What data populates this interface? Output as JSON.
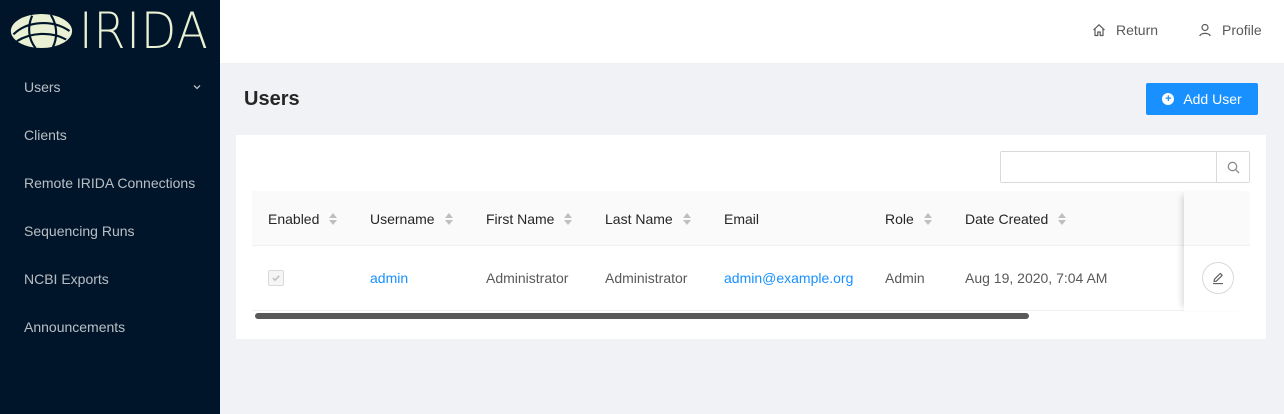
{
  "app": {
    "logo_text": "IRIDA"
  },
  "sidebar": {
    "items": [
      {
        "label": "Users",
        "has_submenu": true
      },
      {
        "label": "Clients"
      },
      {
        "label": "Remote IRIDA Connections"
      },
      {
        "label": "Sequencing Runs"
      },
      {
        "label": "NCBI Exports"
      },
      {
        "label": "Announcements"
      }
    ]
  },
  "header": {
    "return_label": "Return",
    "return_icon": "home-icon",
    "profile_label": "Profile",
    "profile_icon": "user-icon"
  },
  "page": {
    "title": "Users",
    "add_button_label": "Add User",
    "add_button_icon": "plus-circle-icon"
  },
  "search": {
    "value": "",
    "placeholder": "",
    "icon": "search-icon"
  },
  "table": {
    "columns": [
      "Enabled",
      "Username",
      "First Name",
      "Last Name",
      "Email",
      "Role",
      "Date Created"
    ],
    "rows": [
      {
        "enabled": true,
        "username": "admin",
        "first_name": "Administrator",
        "last_name": "Administrator",
        "email": "admin@example.org",
        "role": "Admin",
        "date_created": "Aug 19, 2020, 7:04 AM"
      }
    ],
    "edit_icon": "edit-icon"
  },
  "colors": {
    "sidebar_bg": "#001529",
    "accent": "#1890ff",
    "page_bg": "#f0f2f5",
    "logo": "#e9f0d4"
  }
}
